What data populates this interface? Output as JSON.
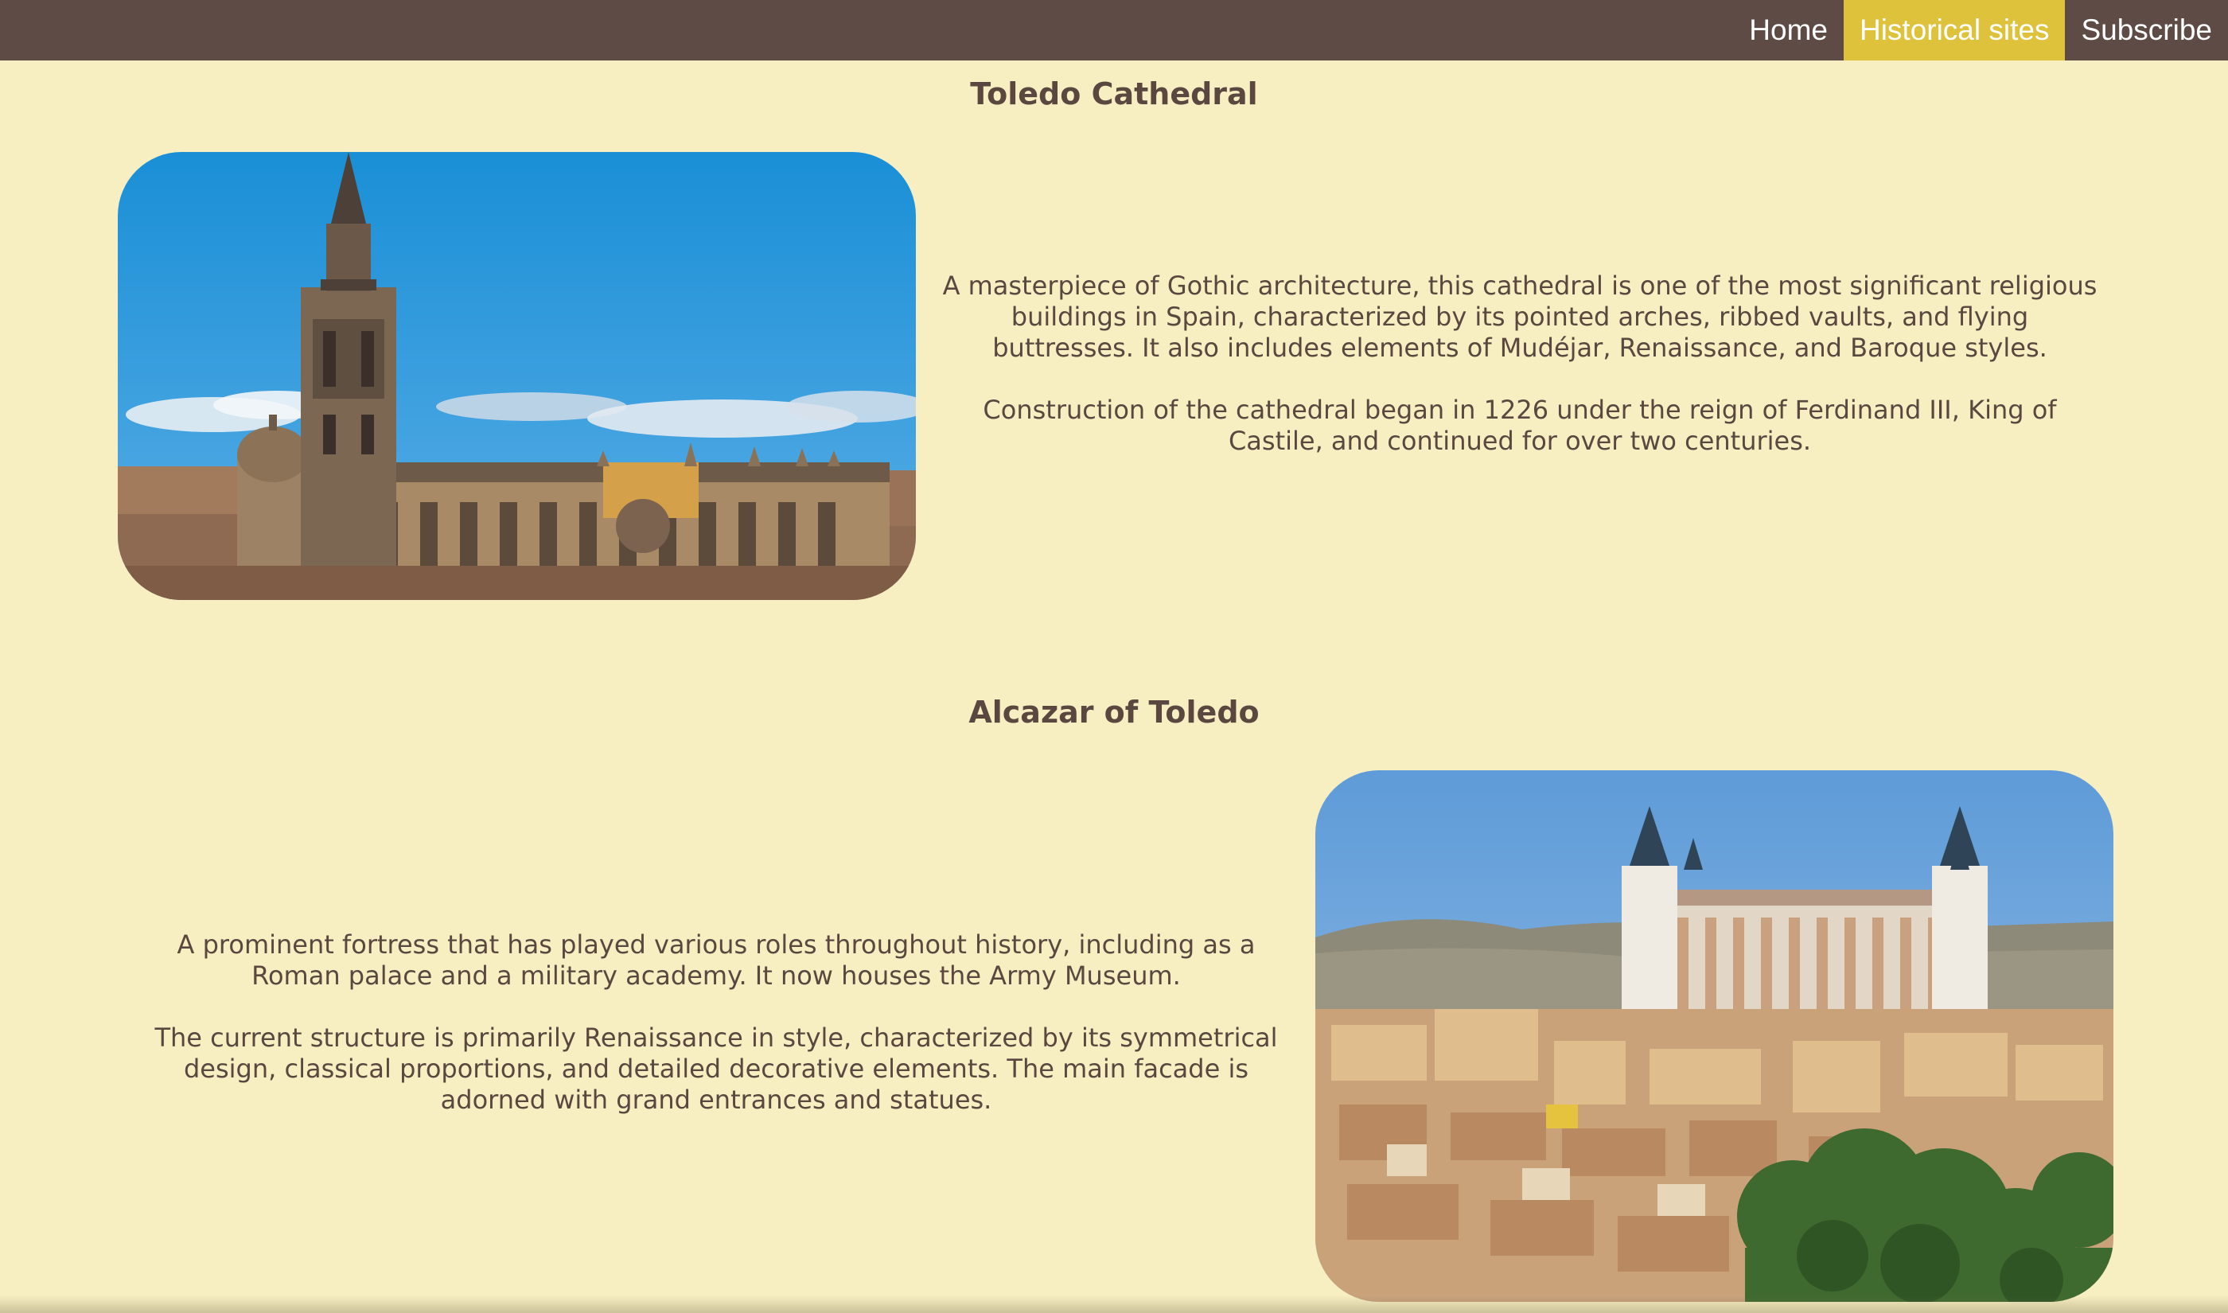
{
  "nav": {
    "items": [
      {
        "label": "Home",
        "active": false
      },
      {
        "label": "Historical sites",
        "active": true
      },
      {
        "label": "Subscribe",
        "active": false
      }
    ],
    "active_color": "#dec23b",
    "bar_color": "#5e4b45"
  },
  "sections": [
    {
      "title": "Toledo Cathedral",
      "image_subject": "cathedral-photo",
      "paragraphs": [
        "A masterpiece of Gothic architecture, this cathedral is one of the most significant religious buildings in Spain, characterized by its pointed arches, ribbed vaults, and flying buttresses. It also includes elements of Mudéjar, Renaissance, and Baroque styles.",
        "Construction of the cathedral began in 1226 under the reign of Ferdinand III, King of Castile, and continued for over two centuries."
      ]
    },
    {
      "title": "Alcazar of Toledo",
      "image_subject": "alcazar-photo",
      "paragraphs": [
        "A prominent fortress that has played various roles throughout history, including as a Roman palace and a military academy. It now houses the Army Museum.",
        "The current structure is primarily Renaissance in style, characterized by its symmetrical design, classical proportions, and detailed decorative elements. The main facade is adorned with grand entrances and statues."
      ]
    }
  ],
  "page_background": "#f7efc1"
}
